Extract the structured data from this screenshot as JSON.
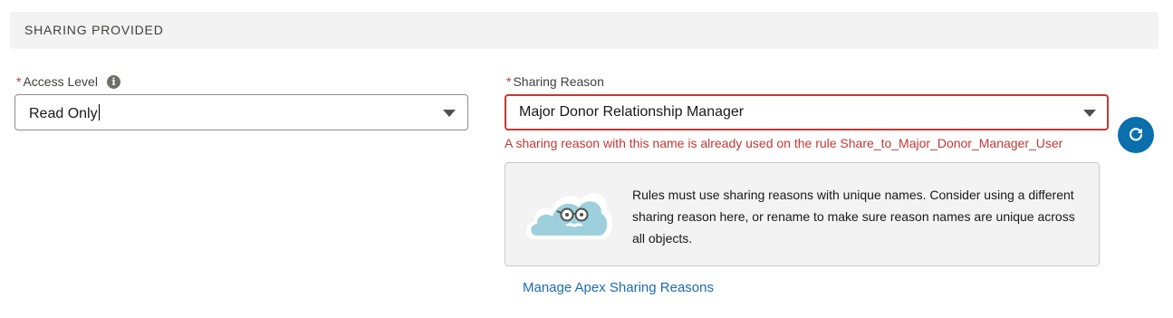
{
  "section": {
    "title": "SHARING PROVIDED"
  },
  "access_level": {
    "required_mark": "*",
    "label": "Access Level",
    "info_icon": "info-icon",
    "value": "Read Only"
  },
  "sharing_reason": {
    "required_mark": "*",
    "label": "Sharing Reason",
    "value": "Major Donor Relationship Manager",
    "error": "A sharing reason with this name is already used on the rule Share_to_Major_Donor_Manager_User"
  },
  "refresh_button": {
    "icon": "refresh-icon"
  },
  "info_box": {
    "illustration": "cloud-with-glasses-illustration",
    "message": "Rules must use sharing reasons with unique names. Consider using a different sharing reason here, or rename to make sure reason names are unique across all objects."
  },
  "link": {
    "label": "Manage Apex Sharing Reasons"
  },
  "colors": {
    "error": "#c23934",
    "brand": "#0b6fad",
    "link": "#1b6cb0",
    "header_bg": "#f3f3f3"
  }
}
